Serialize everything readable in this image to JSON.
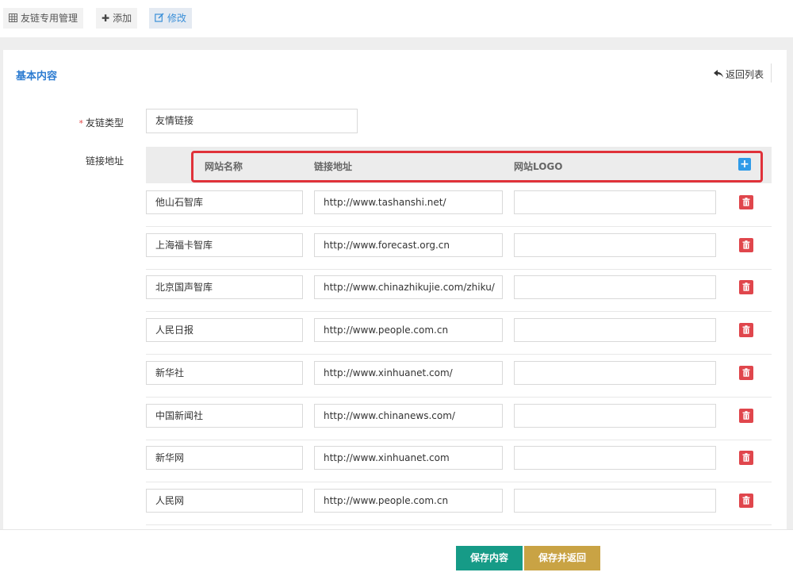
{
  "toolbar": {
    "manage_label": "友链专用管理",
    "add_label": "添加",
    "edit_label": "修改",
    "manage_icon": "table-icon",
    "add_icon": "plus-icon",
    "edit_icon": "edit-icon"
  },
  "panel": {
    "title": "基本内容",
    "back_label": "返回列表"
  },
  "form": {
    "type_label": "友链类型",
    "type_value": "友情链接",
    "links_label": "链接地址"
  },
  "table": {
    "headers": {
      "name": "网站名称",
      "url": "链接地址",
      "logo": "网站LOGO"
    },
    "rows": [
      {
        "name": "他山石智库",
        "url": "http://www.tashanshi.net/",
        "logo": ""
      },
      {
        "name": "上海福卡智库",
        "url": "http://www.forecast.org.cn",
        "logo": ""
      },
      {
        "name": "北京国声智库",
        "url": "http://www.chinazhikujie.com/zhiku/",
        "logo": ""
      },
      {
        "name": "人民日报",
        "url": "http://www.people.com.cn",
        "logo": ""
      },
      {
        "name": "新华社",
        "url": "http://www.xinhuanet.com/",
        "logo": ""
      },
      {
        "name": "中国新闻社",
        "url": "http://www.chinanews.com/",
        "logo": ""
      },
      {
        "name": "新华网",
        "url": "http://www.xinhuanet.com",
        "logo": ""
      },
      {
        "name": "人民网",
        "url": "http://www.people.com.cn",
        "logo": ""
      }
    ]
  },
  "footer": {
    "save_label": "保存内容",
    "save_return_label": "保存并返回"
  },
  "colors": {
    "accent_blue": "#2d7cd1",
    "delete_red": "#e0464c",
    "save_green": "#169b87",
    "save_gold": "#c9a344",
    "highlight_red": "#e0323a"
  }
}
